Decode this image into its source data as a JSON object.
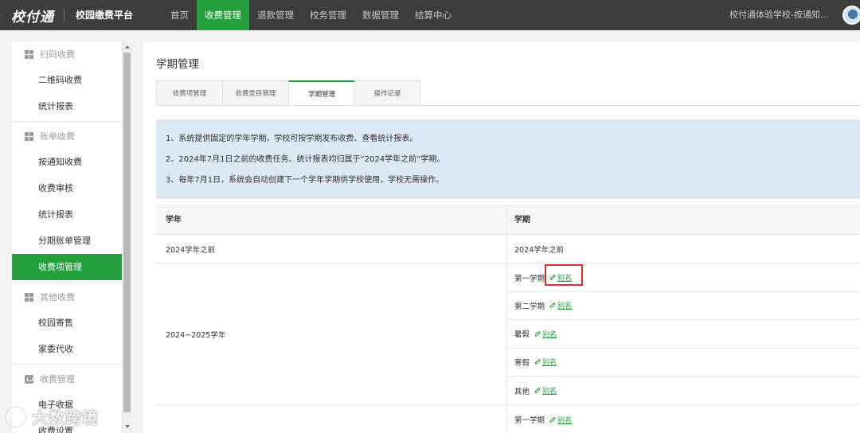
{
  "topbar": {
    "logo": "校付通",
    "platform": "校园缴费平台",
    "nav": [
      {
        "label": "首页"
      },
      {
        "label": "收费管理"
      },
      {
        "label": "退款管理"
      },
      {
        "label": "校务管理"
      },
      {
        "label": "数据管理"
      },
      {
        "label": "结算中心"
      }
    ],
    "active_nav": "收费管理",
    "school": "校付通体验学校-按通知..."
  },
  "sidebar": {
    "groups": [
      {
        "label": "扫码收费",
        "icon": "grid-icon",
        "items": [
          "二维码收费",
          "统计报表"
        ]
      },
      {
        "label": "账单收费",
        "icon": "grid-icon",
        "items": [
          "按通知收费",
          "收费审核",
          "统计报表",
          "分期账单管理",
          "收费项管理"
        ]
      },
      {
        "label": "其他收费",
        "icon": "grid-icon",
        "items": [
          "校园寄售",
          "家委代收"
        ]
      },
      {
        "label": "收费管理",
        "icon": "receipt-icon",
        "items": [
          "电子收据",
          "收费设置"
        ]
      }
    ],
    "active_item": "收费项管理"
  },
  "main": {
    "page_title": "学期管理",
    "tabs": [
      "收费项管理",
      "收费类目管理",
      "学期管理",
      "操作记录"
    ],
    "active_tab": "学期管理",
    "info": [
      "1、系统提供固定的学年学期，学校可按学期发布收费、查看统计报表。",
      "2、2024年7月1日之前的收费任务、统计报表均归属于“2024学年之前”学期。",
      "3、每年7月1日，系统会自动创建下一个学年学期供学校使用，学校无需操作。"
    ],
    "table": {
      "headers": [
        "学年",
        "学期"
      ],
      "alias_label": "别名",
      "rows": [
        {
          "year": "2024学年之前",
          "terms": [
            "2024学年之前"
          ],
          "alias": false
        },
        {
          "year": "2024~2025学年",
          "terms": [
            "第一学期",
            "第二学期",
            "暑假",
            "寒假",
            "其他"
          ],
          "alias": true
        },
        {
          "year": "",
          "terms": [
            "第一学期"
          ],
          "alias": true
        }
      ]
    }
  },
  "watermark": "大数跨境",
  "colors": {
    "accent": "#23a03c",
    "topbar": "#3d3d3d",
    "info_bg": "#dde8f6",
    "highlight": "#d9302a"
  }
}
